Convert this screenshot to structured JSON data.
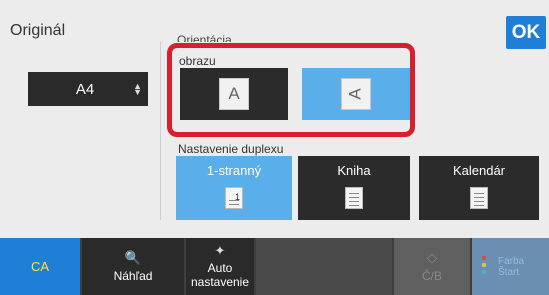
{
  "header": {
    "title": "Originál",
    "ok_label": "OK"
  },
  "original_size": {
    "value": "A4"
  },
  "orientation": {
    "label": "Orientácia",
    "sublabel": "obrazu",
    "portrait_glyph": "A",
    "landscape_glyph": "A",
    "selected": "landscape"
  },
  "duplex": {
    "label": "Nastavenie duplexu",
    "options": [
      {
        "label": "1-stranný",
        "icon": "single-sided-doc-icon"
      },
      {
        "label": "Kniha",
        "icon": "book-doc-icon"
      },
      {
        "label": "Kalendár",
        "icon": "calendar-doc-icon"
      }
    ],
    "selected": "1-stranný"
  },
  "bottom": {
    "ca_label": "CA",
    "preview_label": "Náhľad",
    "auto_label_1": "Auto",
    "auto_label_2": "nastavenie",
    "bw_start_label": "Č/B",
    "color_start_label_1": "Farba",
    "color_start_label_2": "Štart"
  },
  "colors": {
    "accent": "#1f7fd6",
    "selected_blue": "#5aaeea",
    "highlight_red": "#d71f2e",
    "dark_button": "#2b2b2b"
  }
}
